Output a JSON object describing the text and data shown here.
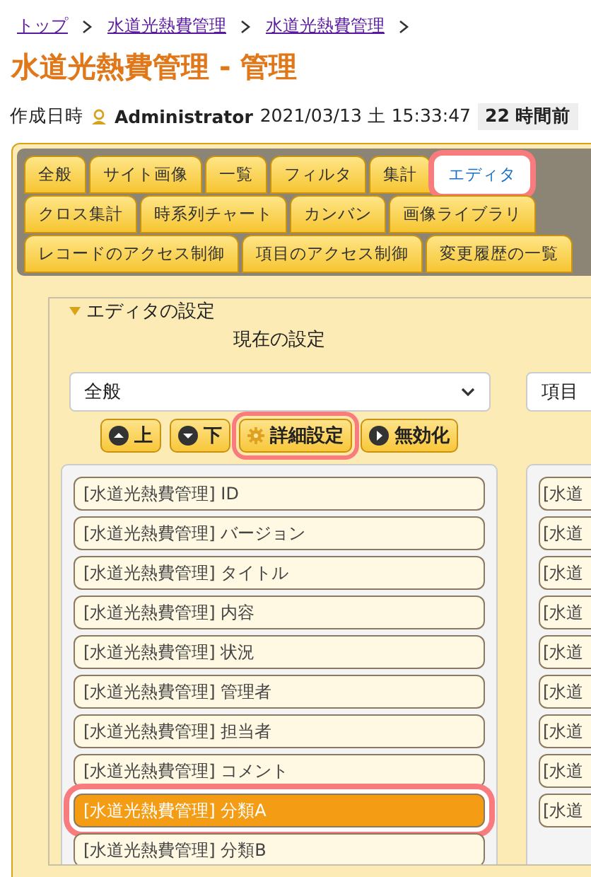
{
  "breadcrumb": [
    "トップ",
    "水道光熱費管理",
    "水道光熱費管理"
  ],
  "title": "水道光熱費管理 - 管理",
  "meta": {
    "label": "作成日時",
    "user": "Administrator",
    "datetime": "2021/03/13 土 15:33:47",
    "ago": "22 時間前"
  },
  "tab_rows": [
    [
      {
        "label": "全般",
        "selected": false,
        "highlighted": false
      },
      {
        "label": "サイト画像",
        "selected": false,
        "highlighted": false
      },
      {
        "label": "一覧",
        "selected": false,
        "highlighted": false
      },
      {
        "label": "フィルタ",
        "selected": false,
        "highlighted": false
      },
      {
        "label": "集計",
        "selected": false,
        "highlighted": false
      },
      {
        "label": "エディタ",
        "selected": true,
        "highlighted": true
      }
    ],
    [
      {
        "label": "クロス集計",
        "selected": false,
        "highlighted": false
      },
      {
        "label": "時系列チャート",
        "selected": false,
        "highlighted": false
      },
      {
        "label": "カンバン",
        "selected": false,
        "highlighted": false
      },
      {
        "label": "画像ライブラリ",
        "selected": false,
        "highlighted": false
      }
    ],
    [
      {
        "label": "レコードのアクセス制御",
        "selected": false,
        "highlighted": false
      },
      {
        "label": "項目のアクセス制御",
        "selected": false,
        "highlighted": false
      },
      {
        "label": "変更履歴の一覧",
        "selected": false,
        "highlighted": false
      }
    ]
  ],
  "editor_settings": {
    "legend": "エディタの設定",
    "current_heading": "現在の設定",
    "current_select": "全般",
    "other_select": "項目",
    "buttons": [
      {
        "kind": "up",
        "label": "上",
        "highlighted": false
      },
      {
        "kind": "down",
        "label": "下",
        "highlighted": false
      },
      {
        "kind": "settings",
        "label": "詳細設定",
        "highlighted": true
      },
      {
        "kind": "disable",
        "label": "無効化",
        "highlighted": false
      }
    ],
    "current_items": [
      {
        "label": "[水道光熱費管理] ID",
        "selected": false
      },
      {
        "label": "[水道光熱費管理] バージョン",
        "selected": false
      },
      {
        "label": "[水道光熱費管理] タイトル",
        "selected": false
      },
      {
        "label": "[水道光熱費管理] 内容",
        "selected": false
      },
      {
        "label": "[水道光熱費管理] 状況",
        "selected": false
      },
      {
        "label": "[水道光熱費管理] 管理者",
        "selected": false
      },
      {
        "label": "[水道光熱費管理] 担当者",
        "selected": false
      },
      {
        "label": "[水道光熱費管理] コメント",
        "selected": false
      },
      {
        "label": "[水道光熱費管理] 分類A",
        "selected": true
      },
      {
        "label": "[水道光熱費管理] 分類B",
        "selected": false
      }
    ],
    "other_items": [
      "[水道",
      "[水道",
      "[水道",
      "[水道",
      "[水道",
      "[水道",
      "[水道",
      "[水道",
      "[水道"
    ]
  }
}
